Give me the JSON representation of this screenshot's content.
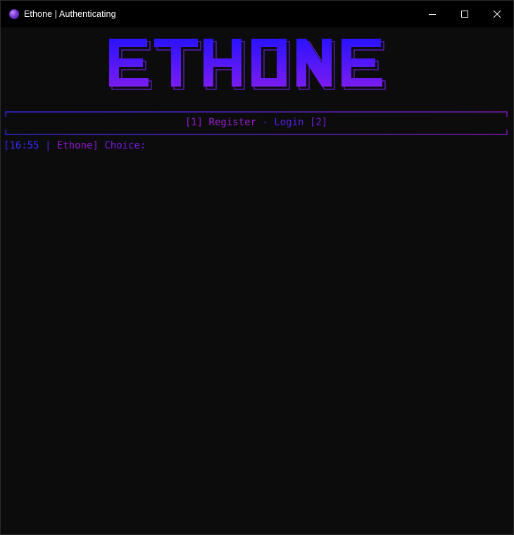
{
  "window": {
    "title": "Ethone | Authenticating",
    "icon": "ethone-logo-icon",
    "controls": [
      "minimize-icon",
      "maximize-icon",
      "close-icon"
    ]
  },
  "banner": {
    "text": "ETHONE",
    "gradient": [
      "#2a12ff",
      "#7a1cf0"
    ]
  },
  "menu": {
    "open_bracket_1": "[1]",
    "register_label": "Register",
    "separator": "-",
    "login_label": "Login",
    "open_bracket_2": "[2]"
  },
  "prompt": {
    "time": "16:55",
    "brand": "Ethone",
    "label": "Choice:"
  },
  "colors": {
    "background": "#0c0c0c",
    "titlebar": "#000000",
    "accent_blue": "#3a2bff",
    "accent_purple": "#8f1ad0"
  }
}
